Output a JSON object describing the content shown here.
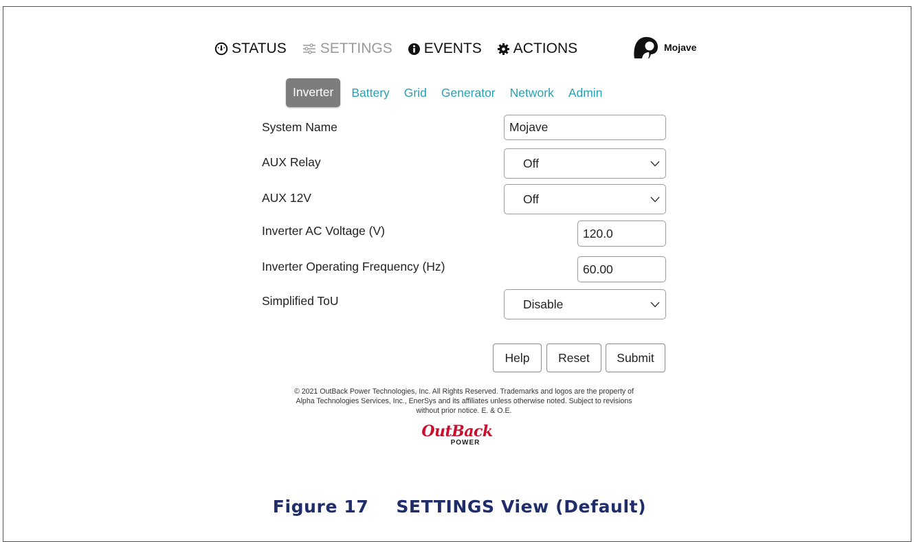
{
  "nav": {
    "items": [
      {
        "label": "STATUS",
        "icon": "speedometer-icon",
        "active": false
      },
      {
        "label": "SETTINGS",
        "icon": "sliders-icon",
        "active": true
      },
      {
        "label": "EVENTS",
        "icon": "info-icon",
        "active": false
      },
      {
        "label": "ACTIONS",
        "icon": "gear-icon",
        "active": false
      }
    ],
    "user_name": "Mojave"
  },
  "tabs": [
    {
      "label": "Inverter",
      "active": true
    },
    {
      "label": "Battery",
      "active": false
    },
    {
      "label": "Grid",
      "active": false
    },
    {
      "label": "Generator",
      "active": false
    },
    {
      "label": "Network",
      "active": false
    },
    {
      "label": "Admin",
      "active": false
    }
  ],
  "form": {
    "system_name": {
      "label": "System Name",
      "value": "Mojave"
    },
    "aux_relay": {
      "label": "AUX Relay",
      "value": "Off"
    },
    "aux_12v": {
      "label": "AUX 12V",
      "value": "Off"
    },
    "ac_voltage": {
      "label": "Inverter AC Voltage (V)",
      "value": "120.0"
    },
    "frequency": {
      "label": "Inverter Operating Frequency (Hz)",
      "value": "60.00"
    },
    "tou": {
      "label": "Simplified ToU",
      "value": "Disable"
    }
  },
  "buttons": {
    "help": "Help",
    "reset": "Reset",
    "submit": "Submit"
  },
  "footer": {
    "copyright_line1": "© 2021 OutBack Power Technologies, Inc. All Rights Reserved. Trademarks and logos are the property of",
    "copyright_line2": "Alpha Technologies Services, Inc., EnerSys and its affiliates unless otherwise noted. Subject to revisions",
    "copyright_line3": "without prior notice. E. & O.E.",
    "logo_main": "OutBack",
    "logo_sub": "POWER"
  },
  "caption": {
    "figure": "Figure 17",
    "title": "SETTINGS View (Default)"
  },
  "colors": {
    "accent": "#2aa0b5",
    "active_tab": "#7d7d7d",
    "brand_red": "#c8102e",
    "caption": "#1f2d6b"
  }
}
